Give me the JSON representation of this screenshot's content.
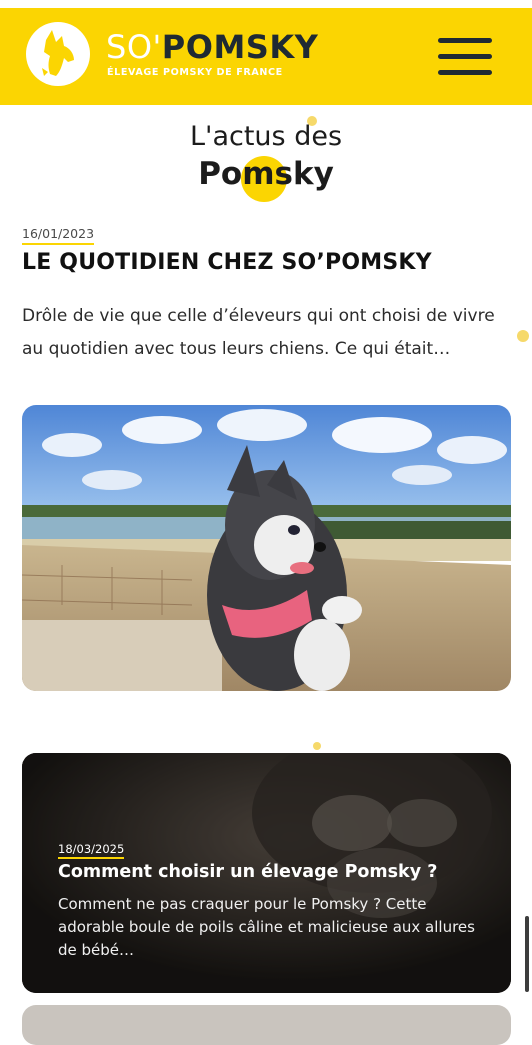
{
  "header": {
    "brand_prefix": "SO'",
    "brand_name": "POMSKY",
    "tagline": "ÉLEVAGE POMSKY DE FRANCE",
    "logo_icon": "dog-head-logo",
    "menu_icon": "hamburger-menu-icon"
  },
  "section": {
    "title_line1": "L'actus des",
    "title_line2": "Pomsky"
  },
  "posts": [
    {
      "date": "16/01/2023",
      "title": "LE QUOTIDIEN CHEZ SO’POMSKY",
      "excerpt": "Drôle de vie que celle d’éleveurs qui ont choisi de vivre au quotidien avec tous leurs chiens. Ce qui était…",
      "image": "pomsky-puppy-on-wall-photo"
    },
    {
      "date": "18/03/2025",
      "title": "Comment choisir un élevage Pomsky ?",
      "excerpt": "Comment ne pas craquer pour le Pomsky ? Cette adorable boule de poils câline et malicieuse aux allures de bébé…",
      "image": "pomsky-puppy-closeup-photo"
    }
  ],
  "colors": {
    "brand_yellow": "#fbd502",
    "dark": "#1f2a33"
  }
}
